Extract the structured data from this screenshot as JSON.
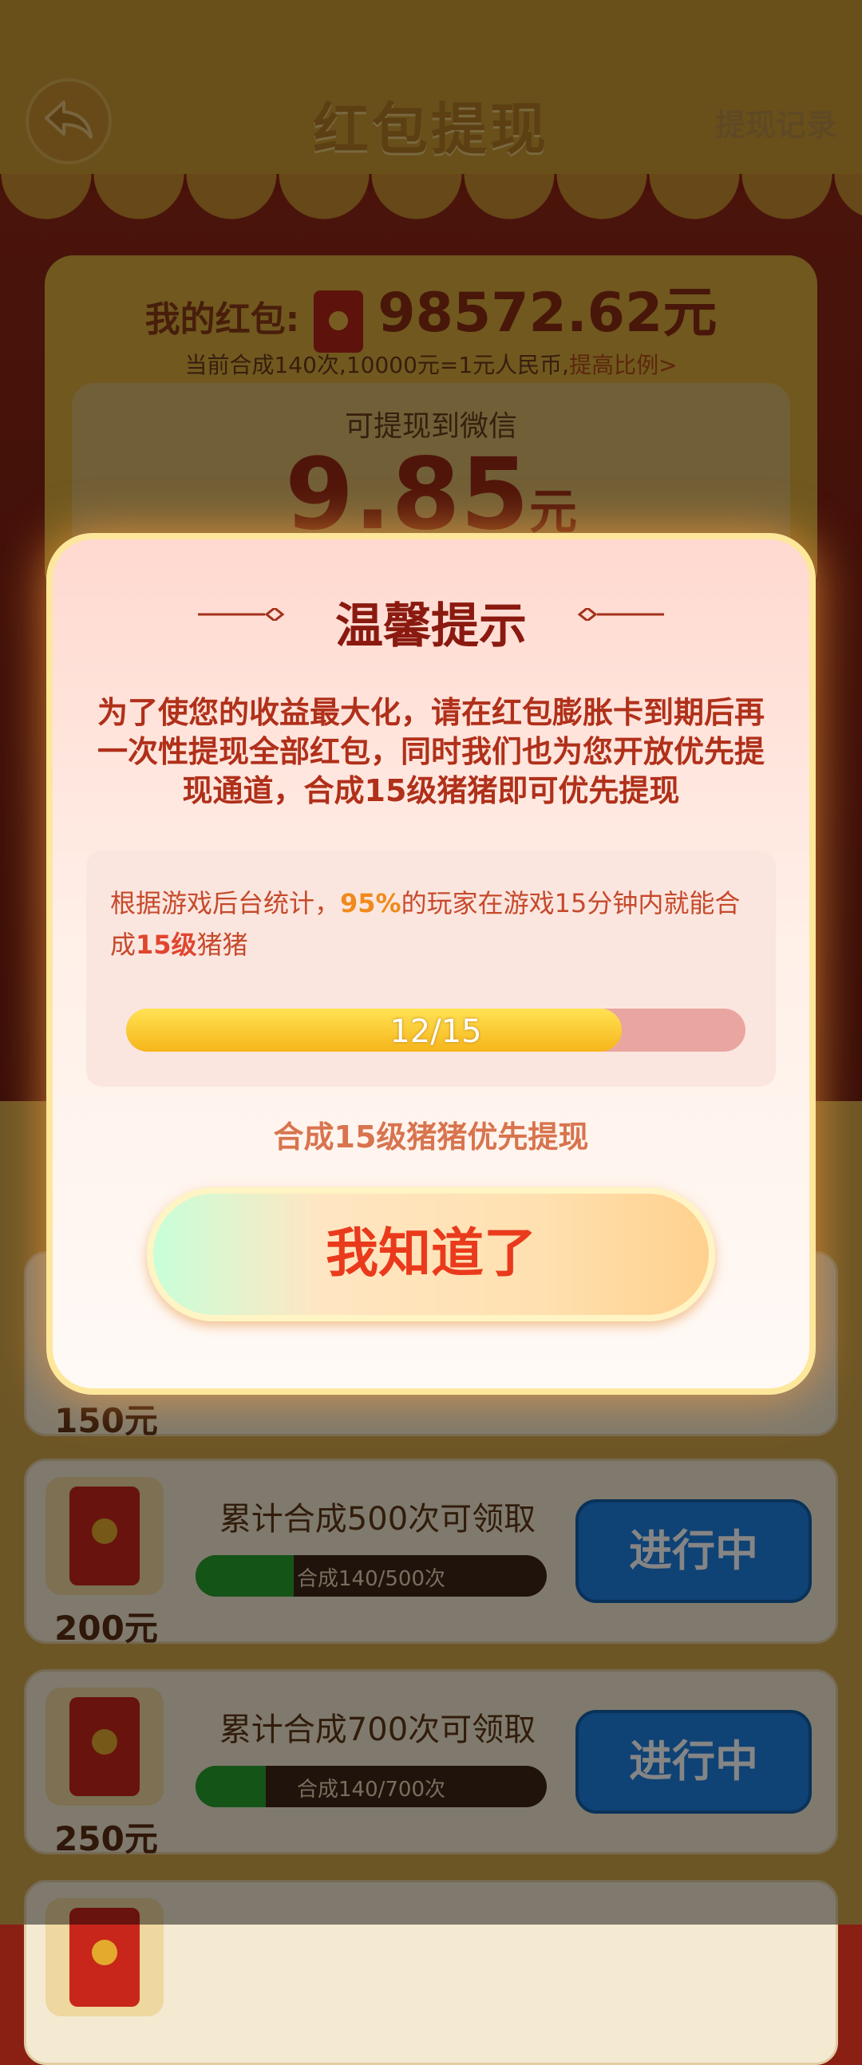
{
  "header": {
    "title": "红包提现",
    "history_link": "提现记录"
  },
  "wallet": {
    "label": "我的红包:",
    "amount": "98572.62元",
    "rate_prefix": "当前合成140次,",
    "rate_suffix": "10000元=1元人民币,",
    "rate_link": "提高比例>",
    "withdraw_label": "可提现到微信",
    "withdraw_amount": "9.85",
    "withdraw_unit": "元"
  },
  "tiers": [
    {
      "reward": "150元",
      "goal": "",
      "progress_text": "",
      "status": ""
    },
    {
      "reward": "200元",
      "goal": "累计合成500次可领取",
      "progress_text": "合成140/500次",
      "progress": 0.28,
      "status": "进行中"
    },
    {
      "reward": "250元",
      "goal": "累计合成700次可领取",
      "progress_text": "合成140/700次",
      "progress": 0.2,
      "status": "进行中"
    }
  ],
  "modal": {
    "title": "温馨提示",
    "body": "为了使您的收益最大化，请在红包膨胀卡到期后再一次性提现全部红包，同时我们也为您开放优先提现通道，合成15级猪猪即可优先提现",
    "info_1": "根据游戏后台统计，",
    "info_percent": "95%",
    "info_2": "的玩家在游戏15分钟内就能合成",
    "info_level": "15级",
    "info_3": "猪猪",
    "progress_label": "12/15",
    "progress": 0.8,
    "priority_text": "合成15级猪猪优先提现",
    "confirm_label": "我知道了"
  },
  "colors": {
    "accent_red": "#ea3a1c",
    "status_blue": "#1e7fe0",
    "progress_gold": "#f6b51a"
  }
}
